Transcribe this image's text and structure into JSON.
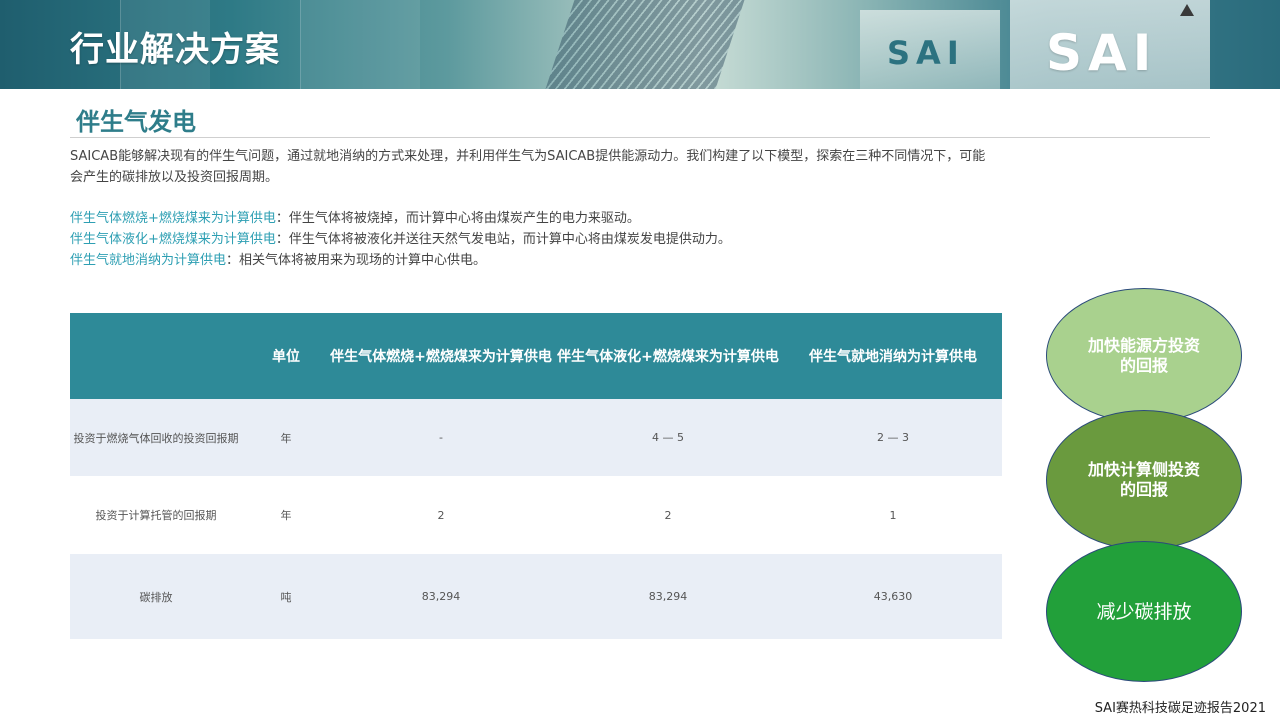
{
  "header": {
    "title": "行业解决方案",
    "logo_small": "SAI",
    "logo_large": "SAI"
  },
  "section": {
    "title": "伴生气发电",
    "intro": "SAICAB能够解决现有的伴生气问题，通过就地消纳的方式来处理，并利用伴生气为SAICAB提供能源动力。我们构建了以下模型，探索在三种不同情况下，可能会产生的碳排放以及投资回报周期。"
  },
  "scenarios": [
    {
      "key": "伴生气体燃烧+燃烧煤来为计算供电",
      "desc": "：伴生气体将被烧掉，而计算中心将由煤炭产生的电力来驱动。"
    },
    {
      "key": "伴生气体液化+燃烧煤来为计算供电",
      "desc": "：伴生气体将被液化并送往天然气发电站，而计算中心将由煤炭发电提供动力。"
    },
    {
      "key": "伴生气就地消纳为计算供电",
      "desc": "：相关气体将被用来为现场的计算中心供电。"
    }
  ],
  "table": {
    "headers": [
      "",
      "单位",
      "伴生气体燃烧+燃烧煤来为计算供电",
      "伴生气体液化+燃烧煤来为计算供电",
      "伴生气就地消纳为计算供电"
    ],
    "rows": [
      [
        "投资于燃烧气体回收的投资回报期",
        "年",
        "-",
        "4 — 5",
        "2 — 3"
      ],
      [
        "投资于计算托管的回报期",
        "年",
        "2",
        "2",
        "1"
      ],
      [
        "碳排放",
        "吨",
        "83,294",
        "83,294",
        "43,630"
      ]
    ]
  },
  "circles": [
    {
      "label": "加快能源方投资的回报",
      "color": "#a9d18e"
    },
    {
      "label": "加快计算侧投资的回报",
      "color": "#6a9a3e"
    },
    {
      "label": "减少碳排放",
      "color": "#22a03a"
    }
  ],
  "footer": "SAI赛热科技碳足迹报告2021"
}
